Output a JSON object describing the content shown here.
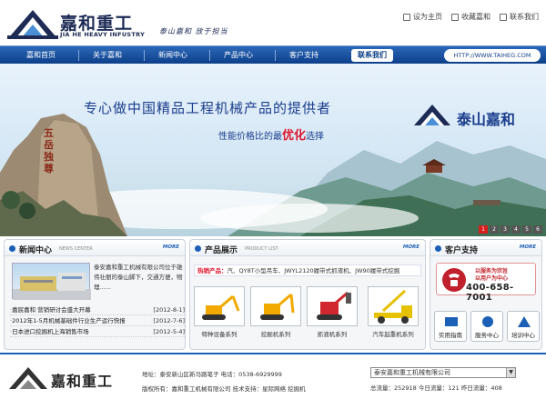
{
  "header": {
    "logo_cn": "嘉和重工",
    "logo_en": "JIA HE HEAVY INFUSTRY",
    "slogan": "泰山嘉和  放于担当",
    "links": [
      "设为主页",
      "收藏嘉和",
      "联系我们"
    ]
  },
  "nav": {
    "items": [
      "嘉和首页",
      "关于嘉和",
      "新闻中心",
      "产品中心",
      "客户支持"
    ],
    "active": "联系我们",
    "url": "HTTP://WWW.TAIHEG.COM"
  },
  "banner": {
    "line1": "专心做中国精品工程机械产品的提供者",
    "line2_pre": "性能价格比的最",
    "line2_hl": "优化",
    "line2_post": "选择",
    "brand": "泰山嘉和",
    "rock_text": "五岳独尊",
    "pages": [
      "1",
      "2",
      "3",
      "4",
      "5",
      "6"
    ]
  },
  "news": {
    "title": "新闻中心",
    "subtitle": "NEWS CENTER",
    "more": "MORE",
    "intro": "泰安嘉和重工机械有限公司位于雄伟壮丽的泰山脚下，交通方便，物理......",
    "items": [
      {
        "title": "嘉宸嘉和 营销研讨会盛大开幕",
        "date": "[2012-8-1]"
      },
      {
        "title": "2012年1-5月机械基础件行业生产运行快报",
        "date": "[2012-7-6]"
      },
      {
        "title": "日本进口挖掘机上海销售市场",
        "date": "[2012-5-4]"
      }
    ]
  },
  "products": {
    "title": "产品展示",
    "subtitle": "PRODUCT LIST",
    "more": "MORE",
    "hot_label": "热销产品：",
    "hot_text": "汽、QY8T小型吊车、JWYL2120履带式抓液机、JW90履带式挖掘",
    "items": [
      "特种设备系列",
      "挖掘机系列",
      "抓液机系列",
      "汽车起重机系列"
    ]
  },
  "support": {
    "title": "客户支持",
    "more": "MORE",
    "line1": "以服务为宗旨",
    "line2": "以用户为中心",
    "phone": "400-658-7001",
    "buttons": [
      "实用指南",
      "服务中心",
      "培训中心"
    ]
  },
  "footer": {
    "logo_cn": "嘉和重工",
    "address": "地址：泰安新山区新马路笔子  电话：0538-6929999",
    "copyright": "版权所有：嘉和重工机械有限公司  技术支持：星际网络  挖掘机",
    "select_value": "泰安嘉和重工机械有限公司",
    "stats": "总流量：252918  今日流量：121  昨日流量：408"
  }
}
